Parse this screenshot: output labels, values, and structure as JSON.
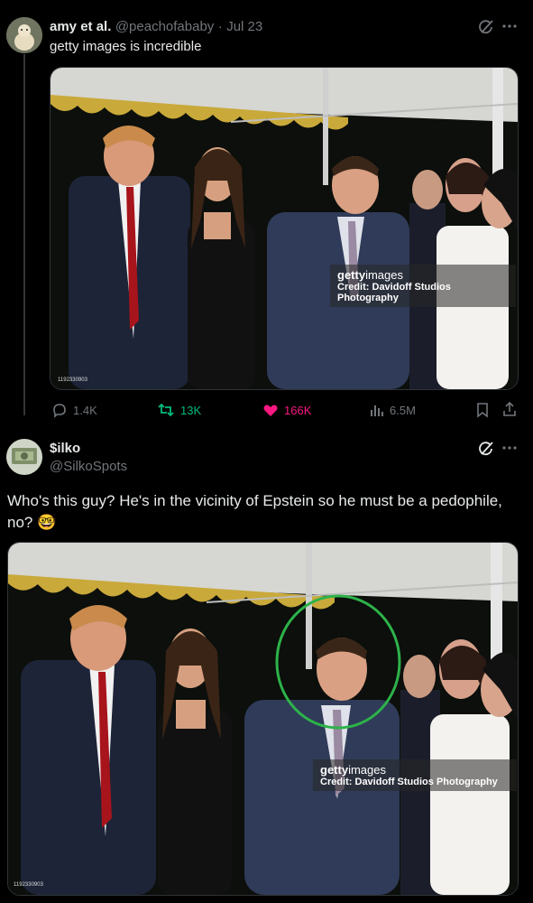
{
  "tweet1": {
    "display_name": "amy et al.",
    "handle": "@peachofababy",
    "sep": "·",
    "date": "Jul 23",
    "text": "getty images is incredible",
    "photo": {
      "watermark_brand_bold": "getty",
      "watermark_brand_light": "images",
      "credit": "Credit: Davidoff Studios Photography",
      "photo_id": "1192330903"
    },
    "actions": {
      "replies": "1.4K",
      "reposts": "13K",
      "likes": "166K",
      "views": "6.5M"
    }
  },
  "tweet2": {
    "display_name": "$ilko",
    "handle": "@SilkoSpots",
    "text_line1": "Who's this guy? He's in the vicinity of Epstein so he must be a pedophile,",
    "text_line2": "no?",
    "emoji": "🤓",
    "photo": {
      "watermark_brand_bold": "getty",
      "watermark_brand_light": "images",
      "credit": "Credit: Davidoff Studios Photography",
      "photo_id": "1192330903"
    }
  },
  "colors": {
    "accent_green": "#00ba7c",
    "like_pink": "#f91880",
    "muted": "#71767b",
    "highlight_circle": "#2db34a"
  },
  "icons": [
    "grok-icon",
    "more-icon",
    "reply-icon",
    "repost-icon",
    "like-icon",
    "views-icon",
    "bookmark-icon",
    "share-icon"
  ]
}
